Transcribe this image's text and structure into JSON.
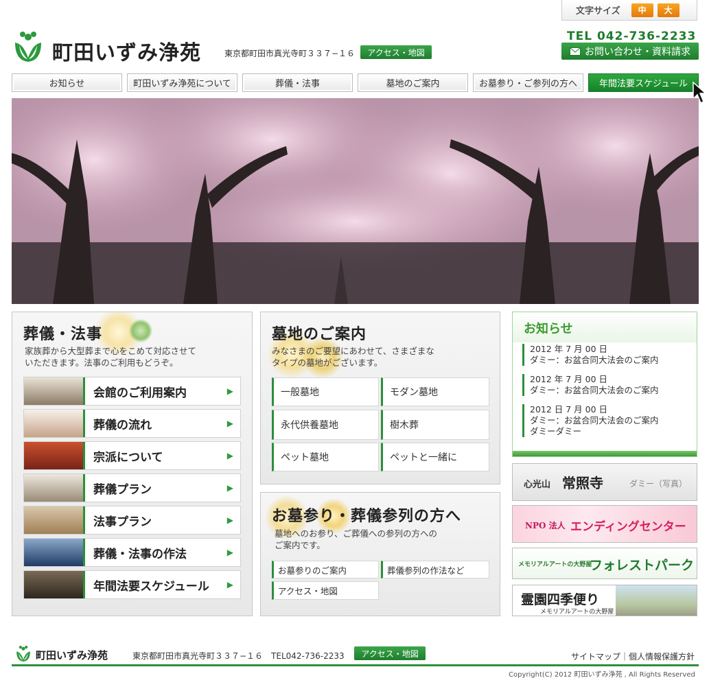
{
  "font_size": {
    "label": "文字サイズ",
    "medium": "中",
    "large": "大"
  },
  "header": {
    "site_title": "町田いずみ浄苑",
    "address": "東京都町田市真光寺町３３７−１６",
    "access_button": "アクセス・地図",
    "tel": "TEL 042-736-2233",
    "contact_button": "お問い合わせ・資料請求"
  },
  "nav": {
    "items": [
      {
        "label": "お知らせ"
      },
      {
        "label": "町田いずみ浄苑について"
      },
      {
        "label": "葬儀・法事"
      },
      {
        "label": "墓地のご案内"
      },
      {
        "label": "お墓参り・ご参列の方へ"
      },
      {
        "label": "年間法要スケジュール"
      }
    ]
  },
  "sougi": {
    "title": "葬儀・法事",
    "description_1": "家族葬から大型葬まで心をこめて対応させて",
    "description_2": "いただきます。法事のご利用もどうぞ。",
    "items": [
      {
        "label": "会館のご利用案内"
      },
      {
        "label": "葬儀の流れ"
      },
      {
        "label": "宗派について"
      },
      {
        "label": "葬儀プラン"
      },
      {
        "label": "法事プラン"
      },
      {
        "label": "葬儀・法事の作法"
      },
      {
        "label": "年間法要スケジュール"
      }
    ],
    "arrow": "▶"
  },
  "bochi": {
    "title": "墓地のご案内",
    "description_1": "みなさまのご要望にあわせて、さまざまな",
    "description_2": "タイプの墓地がございます。",
    "items": [
      {
        "label": "一般墓地"
      },
      {
        "label": "モダン墓地"
      },
      {
        "label": "永代供養墓地"
      },
      {
        "label": "樹木葬"
      },
      {
        "label": "ペット墓地"
      },
      {
        "label": "ペットと一緒に"
      }
    ]
  },
  "ohaka": {
    "title": "お墓参り・葬儀参列の方へ",
    "description_1": "墓地へのお参り、ご葬儀への参列の方への",
    "description_2": "ご案内です。",
    "items": [
      {
        "label": "お墓参りのご案内"
      },
      {
        "label": "葬儀参列の作法など"
      },
      {
        "label": "アクセス・地図"
      }
    ]
  },
  "news": {
    "title": "お知らせ",
    "items": [
      {
        "date": "2012 年 7 月 00 日",
        "text": "ダミー：お盆合同大法会のご案内",
        "text2": ""
      },
      {
        "date": "2012 年 7 月 00 日",
        "text": "ダミー：お盆合同大法会のご案内",
        "text2": ""
      },
      {
        "date": "2012 日 7 月 00 日",
        "text": "ダミー：お盆合同大法会のご案内",
        "text2": "ダミーダミー"
      }
    ]
  },
  "banners": {
    "temple_prefix": "心光山",
    "temple_name": "常照寺",
    "temple_note": "ダミー（写真）",
    "npo_prefix": "NPO 法人",
    "npo_name": "エンディングセンター",
    "forest_prefix": "メモリアルアートの大野屋",
    "forest_name": "フォレストパーク",
    "season_name": "霊園四季便り",
    "season_sub": "メモリアルアートの大野屋"
  },
  "footer": {
    "site_title": "町田いずみ浄苑",
    "address": "東京都町田市真光寺町３３７−１６　TEL042-736-2233",
    "access_button": "アクセス・地図",
    "sitemap": "サイトマップ",
    "divider": "｜",
    "privacy": "個人情報保護方針",
    "copyright": "Copyright(C) 2012 町田いずみ浄苑 , All Rights Reserved"
  },
  "colors": {
    "brand_green": "#2b8f3a",
    "accent_orange": "#f39a1e",
    "news_green": "#3a9b2f"
  }
}
